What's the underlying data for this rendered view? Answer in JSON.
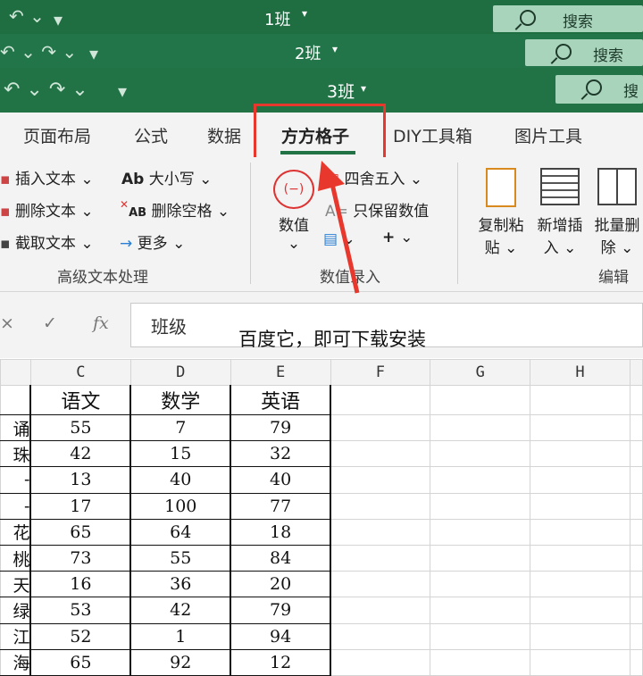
{
  "windows": [
    {
      "title": "1班",
      "search": "搜索"
    },
    {
      "title": "2班",
      "search": "搜索"
    },
    {
      "title": "3班",
      "search": "搜"
    }
  ],
  "ribbon_tabs": [
    "页面布局",
    "公式",
    "数据",
    "方方格子",
    "DIY工具箱",
    "图片工具"
  ],
  "active_tab": "方方格子",
  "ribbon": {
    "advanced_text": {
      "items": [
        "插入文本",
        "删除文本",
        "截取文本"
      ],
      "items2": [
        "大小写",
        "删除空格",
        "更多"
      ],
      "ab_small": "AB",
      "ab_case": "Ab",
      "label": "高级文本处理"
    },
    "number_entry": {
      "value_btn": "数值",
      "round": "四舍五入",
      "keep_value": "只保留数值",
      "plus": "+",
      "label": "数值录入",
      "round_icon_text": "(−)"
    },
    "edit": {
      "copy_paste_1": "复制粘",
      "copy_paste_2": "贴",
      "insert_1": "新增插",
      "insert_2": "入",
      "batch_1": "批量删",
      "batch_2": "除",
      "label": "编辑"
    },
    "dropdown_mark": "⌄"
  },
  "formula_bar": {
    "cell_ref": "班级",
    "content": "百度它，即可下载安装",
    "fx": "fx",
    "cancel": "×",
    "confirm": "✓"
  },
  "columns": [
    "C",
    "D",
    "E",
    "F",
    "G",
    "H"
  ],
  "header_row": [
    "语文",
    "数学",
    "英语"
  ],
  "row_names": [
    "诵",
    "珠",
    "-",
    "-",
    "花",
    "桃",
    "天",
    "绿",
    "江",
    "海"
  ],
  "rows": [
    [
      55,
      7,
      79
    ],
    [
      42,
      15,
      32
    ],
    [
      13,
      40,
      40
    ],
    [
      17,
      100,
      77
    ],
    [
      65,
      64,
      18
    ],
    [
      73,
      55,
      84
    ],
    [
      16,
      36,
      20
    ],
    [
      53,
      42,
      79
    ],
    [
      52,
      1,
      94
    ],
    [
      65,
      92,
      12
    ]
  ],
  "colors": {
    "excel_green": "#217346",
    "highlight_red": "#e8372c"
  }
}
